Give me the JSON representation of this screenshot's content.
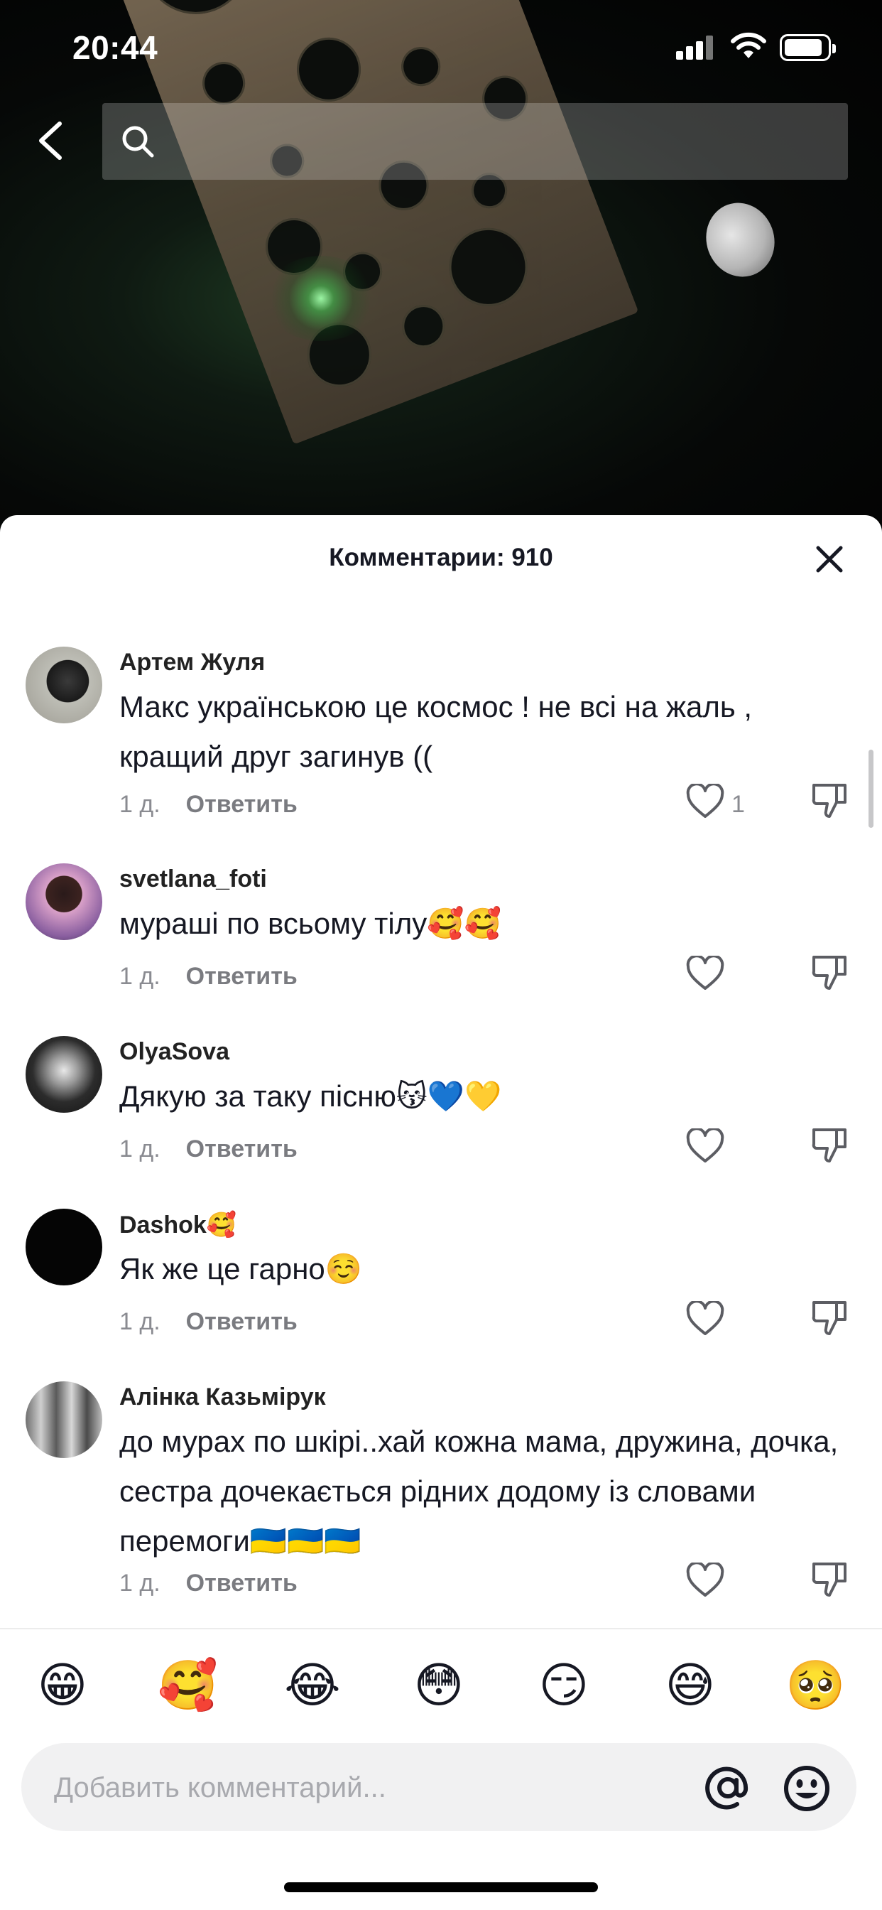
{
  "status_bar": {
    "time": "20:44"
  },
  "search": {
    "placeholder": ""
  },
  "sheet": {
    "title": "Комментарии: 910"
  },
  "comments": [
    {
      "username": "Артем Жуля",
      "text": "Макс українською це космос ! не всі на жаль , кращий друг загинув ((",
      "age": "1 д.",
      "reply_label": "Ответить",
      "likes": "1"
    },
    {
      "username": "svetlana_foti",
      "text": "мураші по всьому тілу🥰🥰",
      "age": "1 д.",
      "reply_label": "Ответить",
      "likes": ""
    },
    {
      "username": "OlyaSova",
      "text": "Дякую за таку пісню😽💙💛",
      "age": "1 д.",
      "reply_label": "Ответить",
      "likes": ""
    },
    {
      "username": "Dashok🥰",
      "text": "Як же це гарно☺️",
      "age": "1 д.",
      "reply_label": "Ответить",
      "likes": ""
    },
    {
      "username": "Алінка Казьмірук",
      "text": "до мурах по шкірі..хай кожна мама, дружина, дочка, сестра дочекається рідних додому із словами перемоги🇺🇦🇺🇦🇺🇦",
      "age": "1 д.",
      "reply_label": "Ответить",
      "likes": ""
    }
  ],
  "emoji_bar": [
    "😁",
    "🥰",
    "😂",
    "😳",
    "😏",
    "😅",
    "🥺"
  ],
  "composer": {
    "placeholder": "Добавить комментарий..."
  },
  "colors": {
    "text": "#161823",
    "muted": "#8a8b91",
    "sheet": "#ffffff"
  }
}
